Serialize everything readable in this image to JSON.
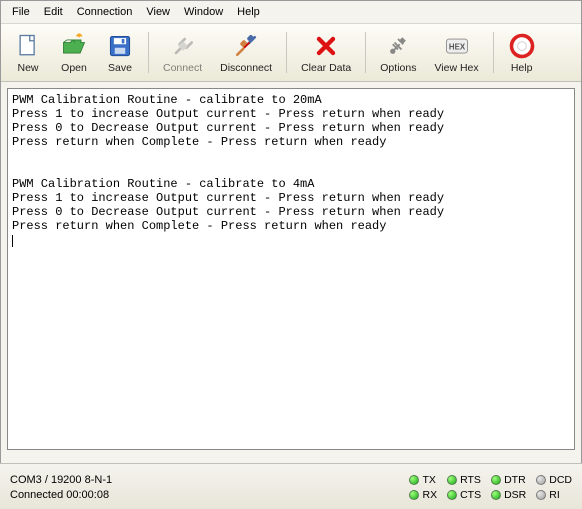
{
  "menu": [
    "File",
    "Edit",
    "Connection",
    "View",
    "Window",
    "Help"
  ],
  "toolbar": {
    "new": {
      "label": "New",
      "icon": "new-icon"
    },
    "open": {
      "label": "Open",
      "icon": "open-icon"
    },
    "save": {
      "label": "Save",
      "icon": "save-icon"
    },
    "connect": {
      "label": "Connect",
      "icon": "connect-icon"
    },
    "disconnect": {
      "label": "Disconnect",
      "icon": "disconnect-icon"
    },
    "clear": {
      "label": "Clear Data",
      "icon": "clear-icon"
    },
    "options": {
      "label": "Options",
      "icon": "options-icon"
    },
    "viewhex": {
      "label": "View Hex",
      "icon": "hex-icon"
    },
    "help": {
      "label": "Help",
      "icon": "help-icon"
    }
  },
  "terminal_text": "PWM Calibration Routine - calibrate to 20mA\nPress 1 to increase Output current - Press return when ready\nPress 0 to Decrease Output current - Press return when ready\nPress return when Complete - Press return when ready\n\n\nPWM Calibration Routine - calibrate to 4mA\nPress 1 to increase Output current - Press return when ready\nPress 0 to Decrease Output current - Press return when ready\nPress return when Complete - Press return when ready\n",
  "status": {
    "port": "COM3 / 19200 8-N-1",
    "connected": "Connected 00:00:08",
    "leds": [
      {
        "name": "TX",
        "on": true
      },
      {
        "name": "RTS",
        "on": true
      },
      {
        "name": "DTR",
        "on": true
      },
      {
        "name": "DCD",
        "on": false
      },
      {
        "name": "RX",
        "on": true
      },
      {
        "name": "CTS",
        "on": true
      },
      {
        "name": "DSR",
        "on": true
      },
      {
        "name": "RI",
        "on": false
      }
    ]
  }
}
